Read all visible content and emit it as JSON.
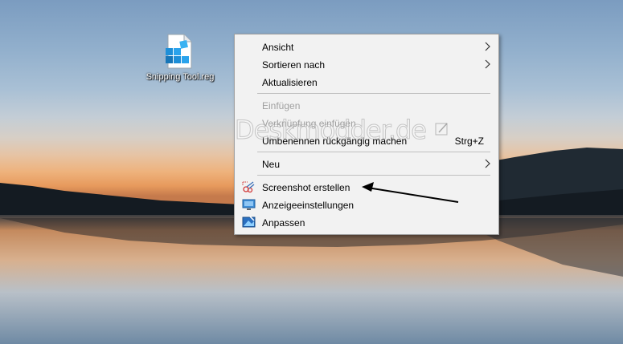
{
  "desktop": {
    "icon": {
      "label": "Snipping Tool.reg",
      "icon_name": "registry-file-icon"
    }
  },
  "context_menu": {
    "items": [
      {
        "label": "Ansicht",
        "submenu": true
      },
      {
        "label": "Sortieren nach",
        "submenu": true
      },
      {
        "label": "Aktualisieren"
      },
      {
        "label": "Einfügen",
        "disabled": true
      },
      {
        "label": "Verknüpfung einfügen",
        "disabled": true
      },
      {
        "label": "Umbenennen rückgängig machen",
        "shortcut": "Strg+Z"
      },
      {
        "label": "Neu",
        "submenu": true
      },
      {
        "label": "Screenshot erstellen",
        "icon": "snip-scissors-icon"
      },
      {
        "label": "Anzeigeeinstellungen",
        "icon": "display-icon"
      },
      {
        "label": "Anpassen",
        "icon": "personalize-icon"
      }
    ]
  },
  "watermark": {
    "text": "Deskmodder.de"
  },
  "colors": {
    "menu_background": "#f2f2f2",
    "disabled_text": "#a0a0a0",
    "separator": "#bfbfbf"
  }
}
